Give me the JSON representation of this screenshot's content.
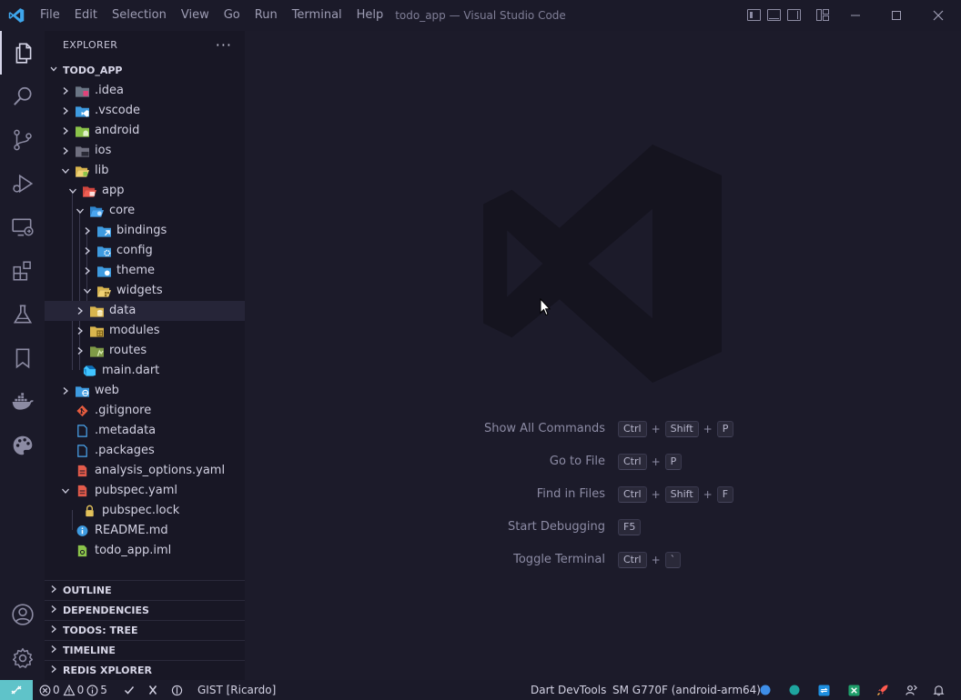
{
  "window": {
    "title": "todo_app — Visual Studio Code"
  },
  "menu": [
    "File",
    "Edit",
    "Selection",
    "View",
    "Go",
    "Run",
    "Terminal",
    "Help"
  ],
  "sidebar": {
    "header": "EXPLORER",
    "more": "···",
    "root": "TODO_APP",
    "tree": [
      {
        "label": ".idea"
      },
      {
        "label": ".vscode"
      },
      {
        "label": "android"
      },
      {
        "label": "ios"
      },
      {
        "label": "lib"
      },
      {
        "label": "app"
      },
      {
        "label": "core"
      },
      {
        "label": "bindings"
      },
      {
        "label": "config"
      },
      {
        "label": "theme"
      },
      {
        "label": "widgets"
      },
      {
        "label": "data"
      },
      {
        "label": "modules"
      },
      {
        "label": "routes"
      },
      {
        "label": "main.dart"
      },
      {
        "label": "web"
      },
      {
        "label": ".gitignore"
      },
      {
        "label": ".metadata"
      },
      {
        "label": ".packages"
      },
      {
        "label": "analysis_options.yaml"
      },
      {
        "label": "pubspec.yaml"
      },
      {
        "label": "pubspec.lock"
      },
      {
        "label": "README.md"
      },
      {
        "label": "todo_app.iml"
      }
    ],
    "sections": [
      "OUTLINE",
      "DEPENDENCIES",
      "TODOS: TREE",
      "TIMELINE",
      "REDIS XPLORER"
    ]
  },
  "editor": {
    "shortcuts": [
      {
        "label": "Show All Commands",
        "keys": [
          "Ctrl",
          "Shift",
          "P"
        ]
      },
      {
        "label": "Go to File",
        "keys": [
          "Ctrl",
          "P"
        ]
      },
      {
        "label": "Find in Files",
        "keys": [
          "Ctrl",
          "Shift",
          "F"
        ]
      },
      {
        "label": "Start Debugging",
        "keys": [
          "F5"
        ]
      },
      {
        "label": "Toggle Terminal",
        "keys": [
          "Ctrl",
          "`"
        ]
      }
    ]
  },
  "statusbar": {
    "errors": "0",
    "warnings": "0",
    "infos": "5",
    "gist": "GIST [Ricardo]",
    "devtools": "Dart DevTools",
    "device": "SM G770F (android-arm64)"
  },
  "colors": {
    "accent": "#5fc3c9",
    "folder_yellow": "#e2c15a",
    "folder_blue": "#3e9be0",
    "folder_green": "#8bc34a",
    "yaml_red": "#e25b4b"
  }
}
